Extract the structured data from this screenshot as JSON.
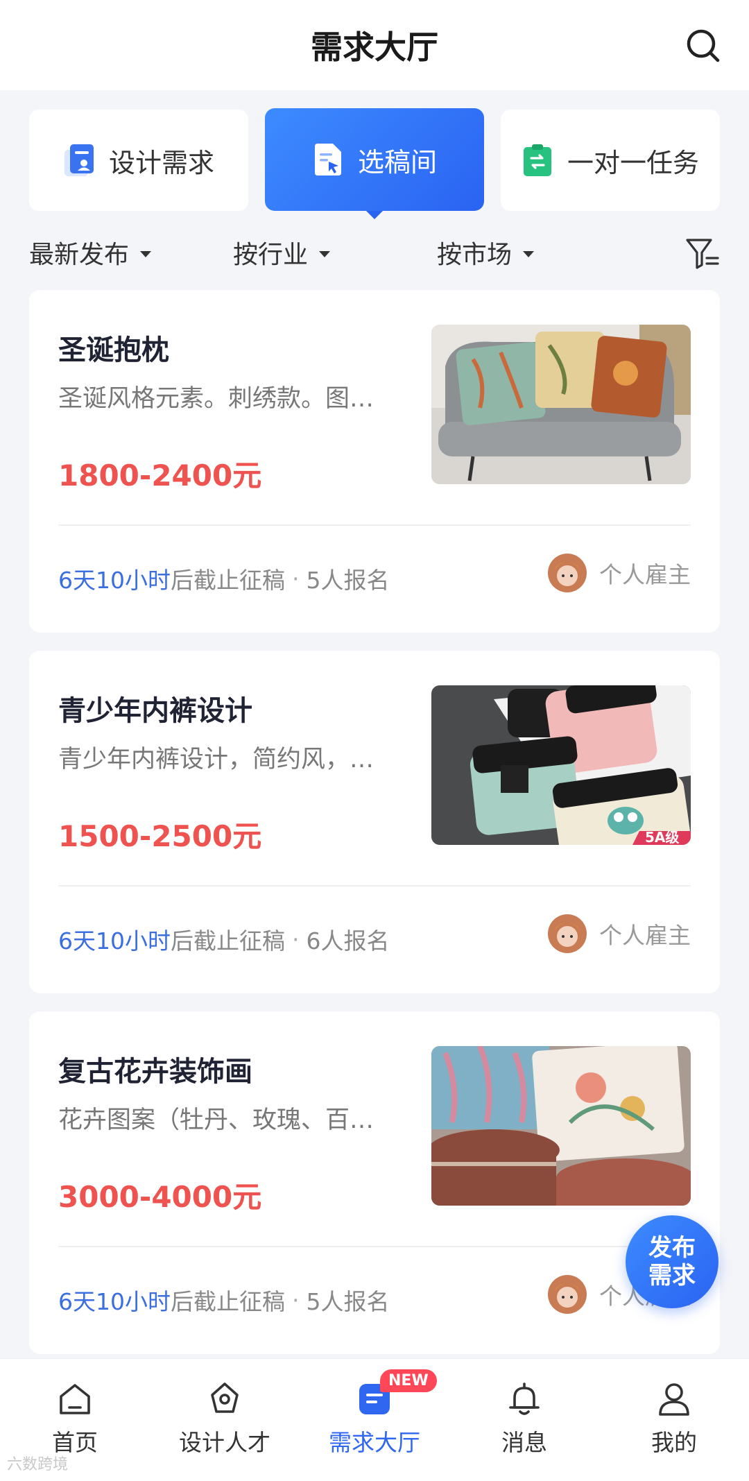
{
  "header": {
    "title": "需求大厅"
  },
  "segments": [
    {
      "label": "设计需求",
      "icon": "design-request-icon"
    },
    {
      "label": "选稿间",
      "icon": "select-draft-icon"
    },
    {
      "label": "一对一任务",
      "icon": "one-on-one-icon"
    }
  ],
  "filters": [
    {
      "label": "最新发布"
    },
    {
      "label": "按行业"
    },
    {
      "label": "按市场"
    }
  ],
  "cards": [
    {
      "title": "圣诞抱枕",
      "desc": "圣诞风格元素。刺绣款。图…",
      "price": "1800-2400元",
      "deadline": "6天10小时",
      "deadline_suffix": "后截止征稿",
      "signups": "5人报名",
      "employer": "个人雇主"
    },
    {
      "title": "青少年内裤设计",
      "desc": "青少年内裤设计，简约风，…",
      "price": "1500-2500元",
      "deadline": "6天10小时",
      "deadline_suffix": "后截止征稿",
      "signups": "6人报名",
      "employer": "个人雇主",
      "img_badge": "5A级"
    },
    {
      "title": "复古花卉装饰画",
      "desc": "花卉图案（牡丹、玫瑰、百…",
      "price": "3000-4000元",
      "deadline": "6天10小时",
      "deadline_suffix": "后截止征稿",
      "signups": "5人报名",
      "employer": "个人雇主"
    }
  ],
  "fab": {
    "line1": "发布",
    "line2": "需求"
  },
  "tabbar": [
    {
      "label": "首页"
    },
    {
      "label": "设计人才"
    },
    {
      "label": "需求大厅"
    },
    {
      "label": "消息"
    },
    {
      "label": "我的"
    }
  ],
  "badge": "NEW",
  "watermark": "六数跨境",
  "colors": {
    "accent": "#2f67f0",
    "price": "#ef5350",
    "background": "#f4f5f9"
  }
}
